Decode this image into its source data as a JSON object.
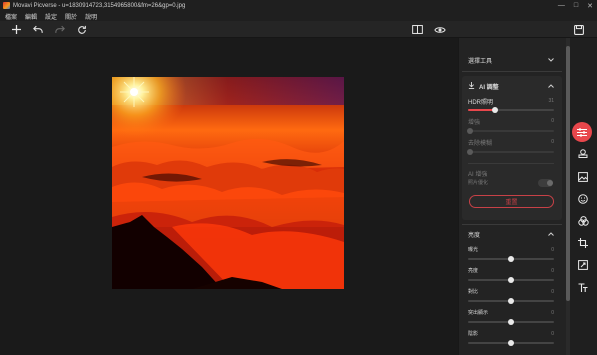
{
  "window": {
    "title": "Movavi Picverse - u=1830914723,3154965800&fm=26&gp=0.jpg",
    "controls": [
      "—",
      "□",
      "✕"
    ]
  },
  "menu": [
    "檔案",
    "編輯",
    "設定",
    "關於",
    "說明"
  ],
  "toolbar": {
    "left_icons": [
      "add-icon",
      "undo-icon",
      "redo-icon",
      "refresh-icon"
    ],
    "right_icons": [
      "compare-icon",
      "preview-eye-icon",
      "save-icon"
    ]
  },
  "panel": {
    "select_tool_label": "選擇工具",
    "ai_section": {
      "title": "AI 調整",
      "hdr_label": "HDR照明",
      "hdr_value": "31",
      "hdr_level": 0.31,
      "dim_sliders": [
        {
          "label": "增強",
          "value": "0"
        },
        {
          "label": "去除模糊",
          "value": "0"
        }
      ],
      "ai_enhance_title": "AI 增強",
      "portrait_label": "照片優化",
      "reset_label": "重置"
    },
    "brightness_section": {
      "title": "亮度",
      "sliders": [
        {
          "label": "曝光",
          "value": "0",
          "level": 0.5
        },
        {
          "label": "亮度",
          "value": "0",
          "level": 0.5
        },
        {
          "label": "對比",
          "value": "0",
          "level": 0.5
        },
        {
          "label": "突出顯示",
          "value": "0",
          "level": 0.5
        },
        {
          "label": "陰影",
          "value": "0",
          "level": 0.5
        }
      ]
    }
  },
  "side_tools": [
    "adjust-icon",
    "stamp-icon",
    "image-icon",
    "face-icon",
    "color-icon",
    "crop-icon",
    "transform-icon",
    "text-icon"
  ],
  "colors": {
    "accent": "#e8474c",
    "panel": "#232323",
    "canvas": "#1a1a1a"
  }
}
